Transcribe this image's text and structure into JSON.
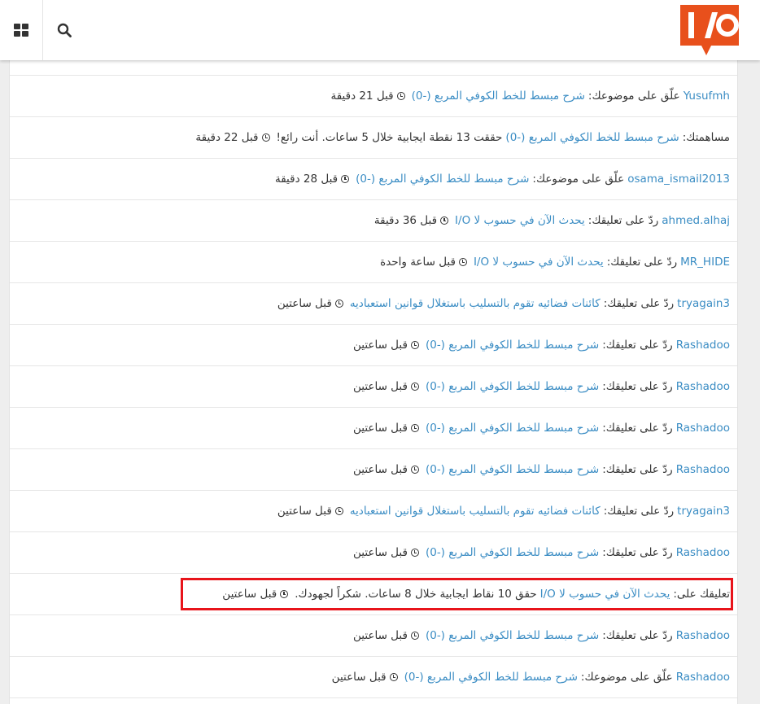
{
  "header": {
    "grid_icon": "grid-icon",
    "search_icon": "search-icon",
    "logo_text": "I/O",
    "logo_color": "#e8501c"
  },
  "colors": {
    "link": "#3b8dc4",
    "highlight": "#e8141b"
  },
  "feed": [
    {
      "user": "Yusufmh",
      "action": "علّق على موضوعك:",
      "target": "شرح مبسط للخط الكوفي المربع (-0)",
      "extra": "",
      "time": "قبل 21 دقيقة"
    },
    {
      "user": "",
      "action": "مساهمتك:",
      "target": "شرح مبسط للخط الكوفي المربع (-0)",
      "extra": "حققت 13 نقطة ايجابية خلال 5 ساعات. أنت رائع!",
      "time": "قبل 22 دقيقة"
    },
    {
      "user": "osama_ismail2013",
      "action": "علّق على موضوعك:",
      "target": "شرح مبسط للخط الكوفي المربع (-0)",
      "extra": "",
      "time": "قبل 28 دقيقة"
    },
    {
      "user": "ahmed.alhaj",
      "action": "ردّ على تعليقك:",
      "target": "يحدث الآن في حسوب لا I/O",
      "extra": "",
      "time": "قبل 36 دقيقة"
    },
    {
      "user": "MR_HIDE",
      "action": "ردّ على تعليقك:",
      "target": "يحدث الآن في حسوب لا I/O",
      "extra": "",
      "time": "قبل ساعة واحدة"
    },
    {
      "user": "tryagain3",
      "action": "ردّ على تعليقك:",
      "target": "كائنات فضائيه تقوم بالتسليب باستغلال قوانين استعباديه",
      "extra": "",
      "time": "قبل ساعتين"
    },
    {
      "user": "Rashadoo",
      "action": "ردّ على تعليقك:",
      "target": "شرح مبسط للخط الكوفي المربع (-0)",
      "extra": "",
      "time": "قبل ساعتين"
    },
    {
      "user": "Rashadoo",
      "action": "ردّ على تعليقك:",
      "target": "شرح مبسط للخط الكوفي المربع (-0)",
      "extra": "",
      "time": "قبل ساعتين"
    },
    {
      "user": "Rashadoo",
      "action": "ردّ على تعليقك:",
      "target": "شرح مبسط للخط الكوفي المربع (-0)",
      "extra": "",
      "time": "قبل ساعتين"
    },
    {
      "user": "Rashadoo",
      "action": "ردّ على تعليقك:",
      "target": "شرح مبسط للخط الكوفي المربع (-0)",
      "extra": "",
      "time": "قبل ساعتين"
    },
    {
      "user": "tryagain3",
      "action": "ردّ على تعليقك:",
      "target": "كائنات فضائيه تقوم بالتسليب باستغلال قوانين استعباديه",
      "extra": "",
      "time": "قبل ساعتين"
    },
    {
      "user": "Rashadoo",
      "action": "ردّ على تعليقك:",
      "target": "شرح مبسط للخط الكوفي المربع (-0)",
      "extra": "",
      "time": "قبل ساعتين"
    },
    {
      "user": "",
      "action": "تعليقك على:",
      "target": "يحدث الآن في حسوب لا I/O",
      "extra": "حقق 10 نقاط ايجابية خلال 8 ساعات. شكراً لجهودك.",
      "time": "قبل ساعتين",
      "highlighted": true
    },
    {
      "user": "Rashadoo",
      "action": "ردّ على تعليقك:",
      "target": "شرح مبسط للخط الكوفي المربع (-0)",
      "extra": "",
      "time": "قبل ساعتين"
    },
    {
      "user": "Rashadoo",
      "action": "علّق على موضوعك:",
      "target": "شرح مبسط للخط الكوفي المربع (-0)",
      "extra": "",
      "time": "قبل ساعتين"
    }
  ]
}
